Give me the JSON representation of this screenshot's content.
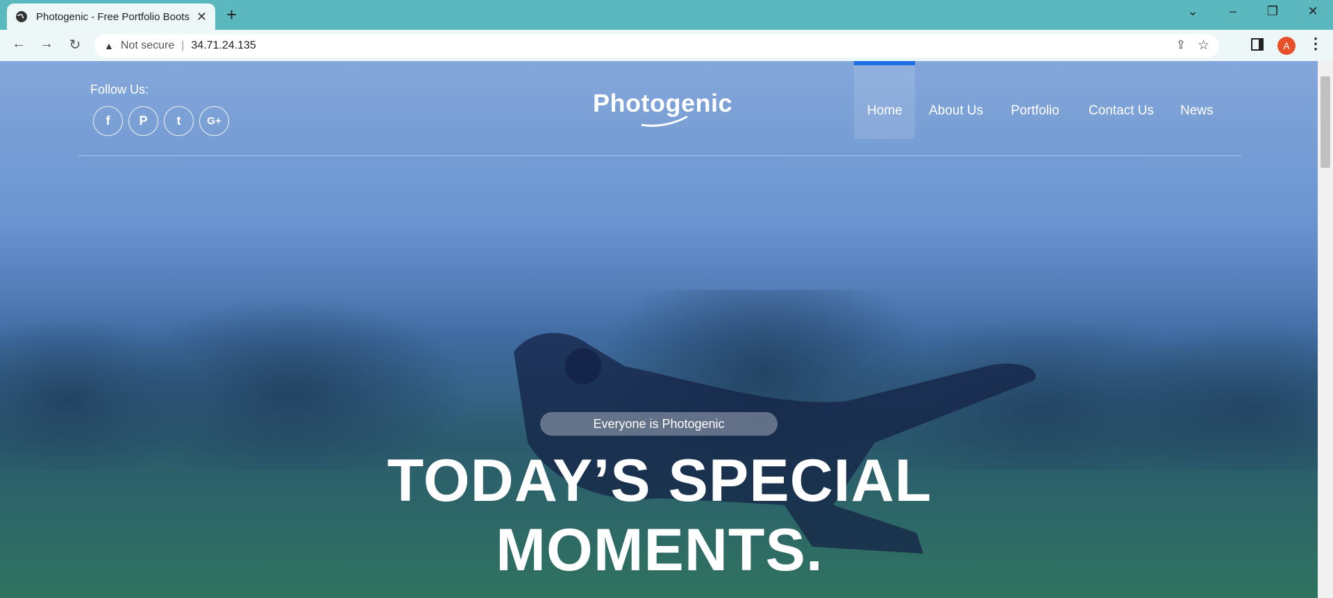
{
  "browser": {
    "tab_title": "Photogenic - Free Portfolio Boots",
    "tab_close": "✕",
    "new_tab": "+",
    "security_label": "Not secure",
    "url": "34.71.24.135",
    "profile_initial": "A"
  },
  "header": {
    "follow_label": "Follow Us:",
    "social": [
      {
        "icon": "facebook-icon",
        "glyph": "f"
      },
      {
        "icon": "pinterest-icon",
        "glyph": "P"
      },
      {
        "icon": "twitter-icon",
        "glyph": "t"
      },
      {
        "icon": "google-plus-icon",
        "glyph": "G+"
      }
    ],
    "logo": "Photogenic",
    "nav": [
      {
        "label": "Home",
        "active": true
      },
      {
        "label": "About Us"
      },
      {
        "label": "Portfolio"
      },
      {
        "label": "Contact Us"
      },
      {
        "label": "News"
      }
    ]
  },
  "hero": {
    "tagline": "Everyone is Photogenic",
    "headline_line1": "TODAY’S SPECIAL",
    "headline_line2": "MOMENTS."
  },
  "colors": {
    "tab_strip": "#5bb8bf",
    "active_nav_bar": "#1a6ee6",
    "avatar": "#e8502a"
  }
}
